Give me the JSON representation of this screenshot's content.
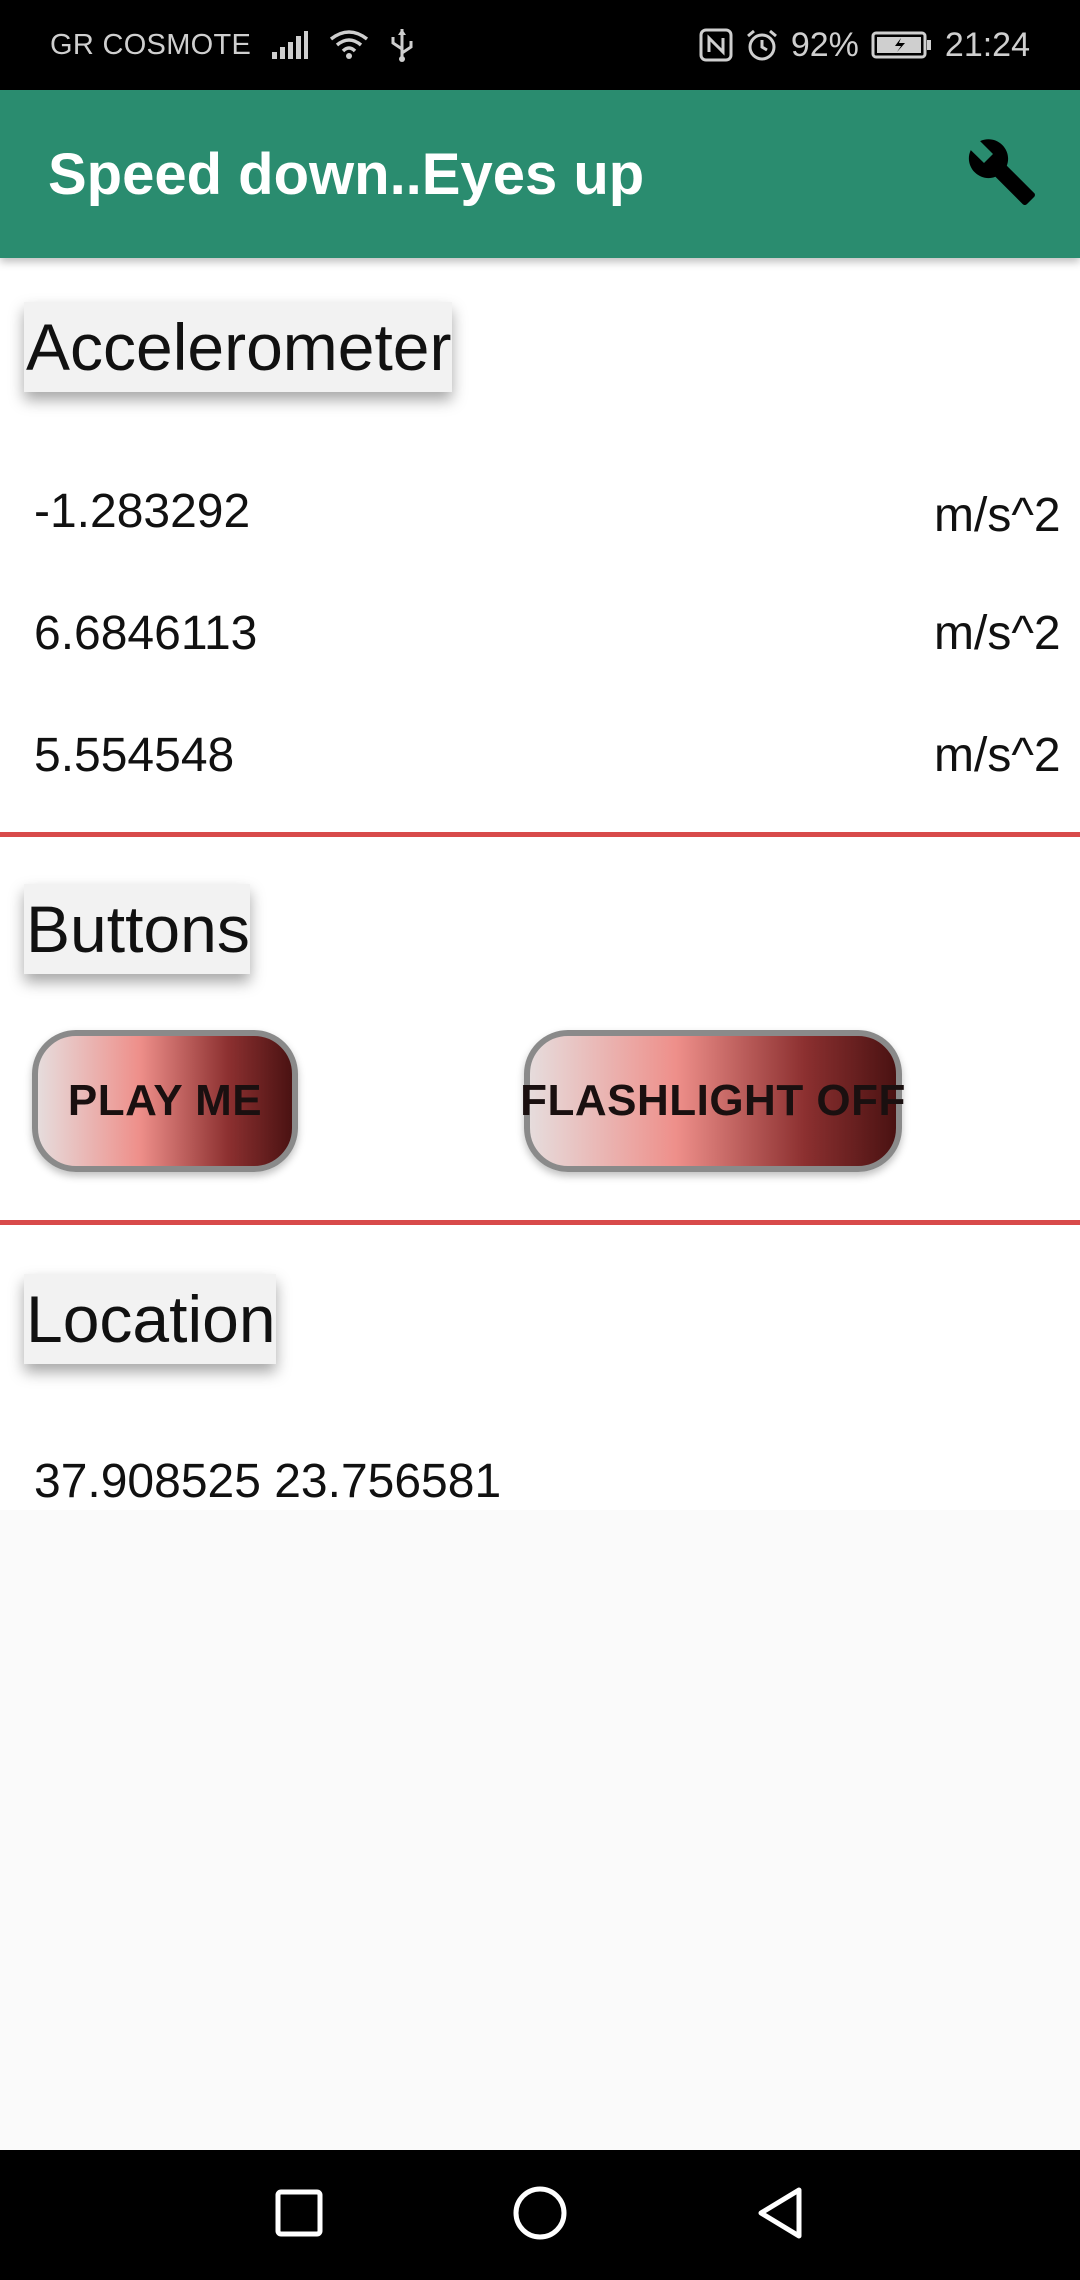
{
  "status_bar": {
    "carrier": "GR COSMOTE",
    "battery": "92%",
    "time": "21:24",
    "icons": [
      "signal-icon",
      "wifi-icon",
      "usb-icon",
      "nfc-icon",
      "alarm-icon",
      "battery-icon"
    ]
  },
  "app_bar": {
    "title": "Speed down..Eyes up",
    "settings_icon": "wrench-icon",
    "background": "#2a8c6f"
  },
  "accelerometer": {
    "title": "Accelerometer",
    "readings": [
      {
        "value": "-1.283292",
        "unit": "m/s^2"
      },
      {
        "value": "6.6846113",
        "unit": "m/s^2"
      },
      {
        "value": "5.554548",
        "unit": "m/s^2"
      }
    ]
  },
  "buttons_section": {
    "title": "Buttons",
    "play_label": "PLAY ME",
    "flashlight_label": "FLASHLIGHT OFF"
  },
  "location": {
    "title": "Location",
    "coordinates": "37.908525 23.756581"
  },
  "nav_bar": {
    "icons": [
      "recents-icon",
      "home-icon",
      "back-icon"
    ]
  },
  "colors": {
    "divider": "#d84a4a",
    "accent": "#2a8c6f"
  }
}
